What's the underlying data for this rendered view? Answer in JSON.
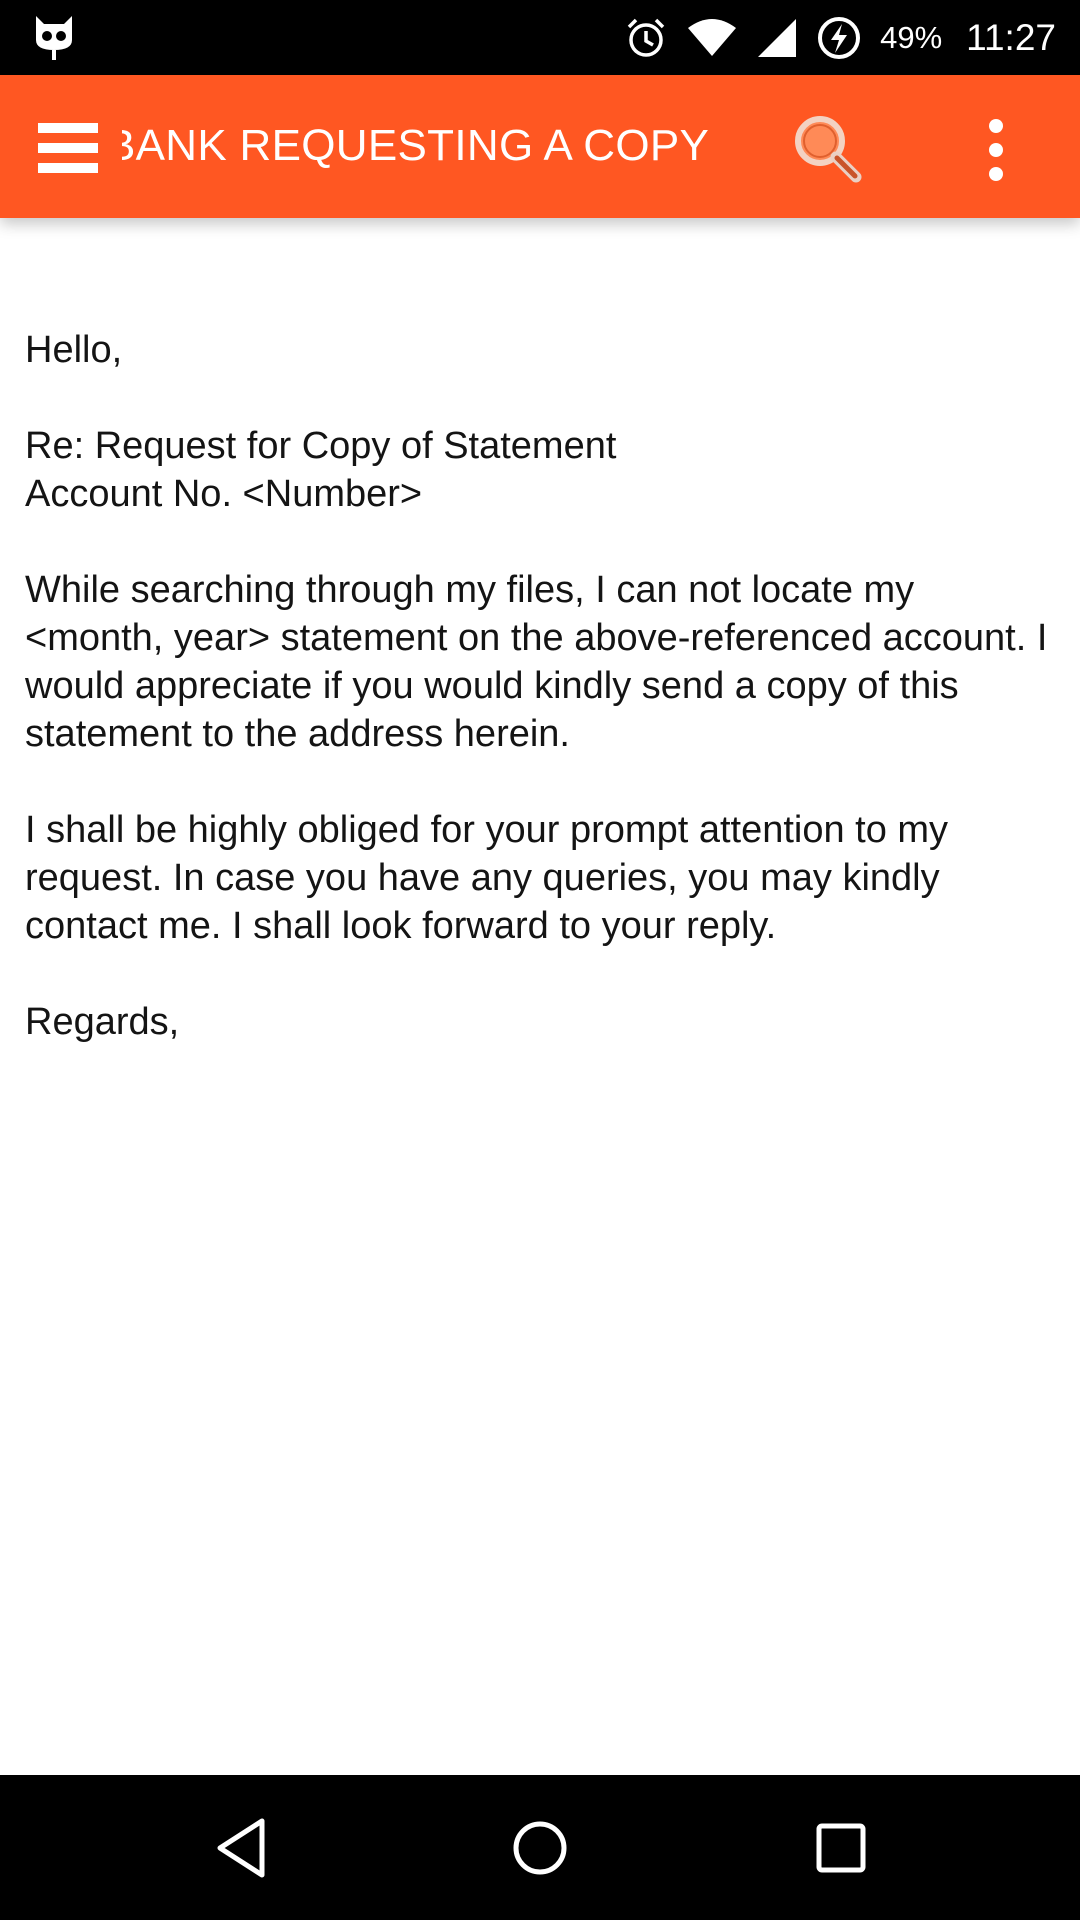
{
  "status_bar": {
    "left_icon": "cyanogen-mascot-icon",
    "icons": [
      "alarm-icon",
      "wifi-icon",
      "cell-signal-icon",
      "battery-charging-icon"
    ],
    "battery": "49%",
    "time": "11:27"
  },
  "app_bar": {
    "title": "BANK REQUESTING A COPY OF STATEMENT",
    "menu_icon": "hamburger-menu-icon",
    "search_icon": "search-icon",
    "overflow_icon": "more-vertical-icon",
    "color": "#ff5722"
  },
  "letter": {
    "greeting": "Hello,",
    "subject": "Re: Request for Copy of Statement",
    "account": "Account No. <Number>",
    "paragraph1": "While searching through my files, I can not locate my <month, year> statement on the above-referenced account. I would appreciate if you would kindly send a copy of this statement to the address herein.",
    "paragraph2": "I shall be highly obliged for your prompt attention to my request. In case you have any queries, you may kindly contact me. I shall look forward to your reply.",
    "closing": "Regards,"
  },
  "nav_bar": {
    "back_icon": "back-triangle-icon",
    "home_icon": "home-circle-icon",
    "recents_icon": "recents-square-icon"
  }
}
